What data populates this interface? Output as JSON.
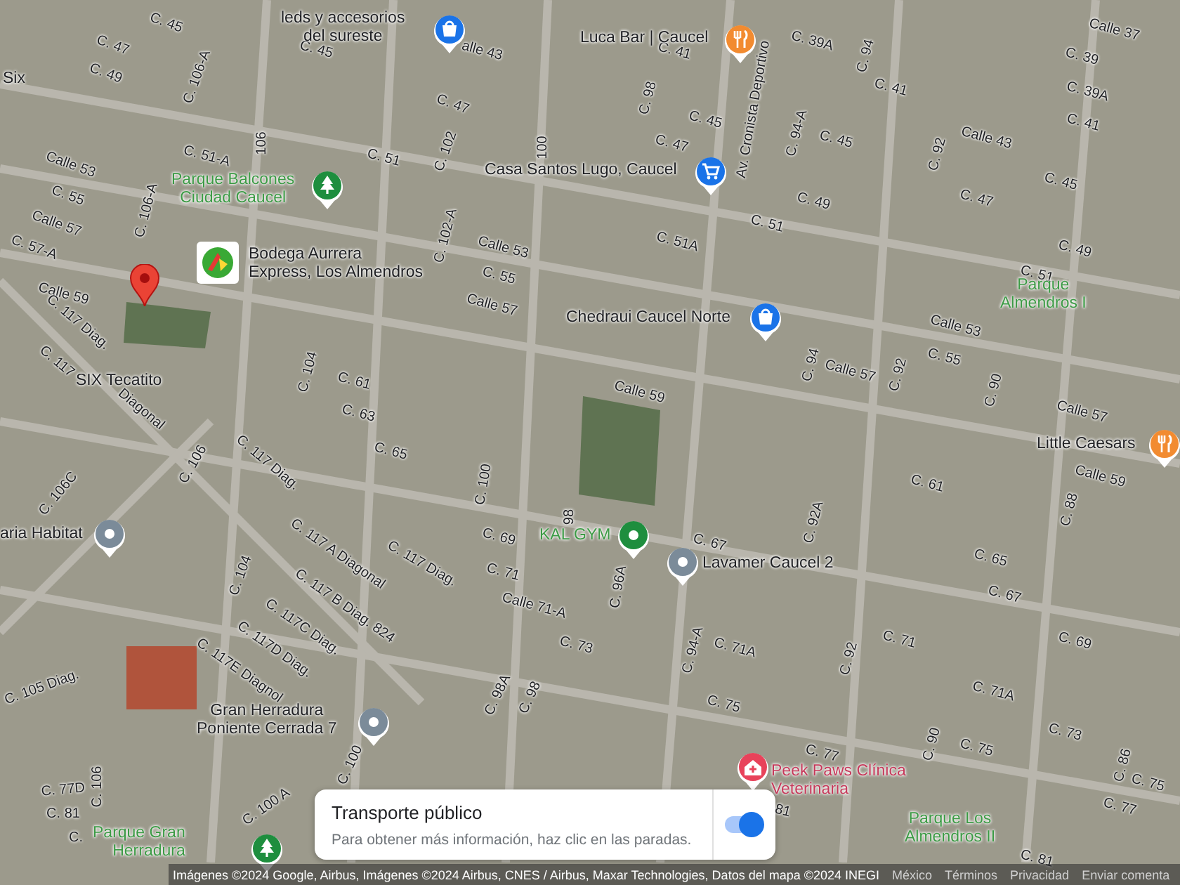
{
  "map": {
    "places": [
      {
        "lines": [
          "leds y accesorios",
          "del sureste"
        ],
        "kind": "shopping",
        "color": "#1a73e8"
      },
      {
        "lines": [
          "Luca Bar | Caucel"
        ],
        "kind": "restaurant",
        "color": "#f28b30"
      },
      {
        "lines": [
          "Casa Santos Lugo, Caucel"
        ],
        "kind": "grocery",
        "color": "#1a73e8"
      },
      {
        "lines": [
          "Parque Balcones",
          "Ciudad Caucel"
        ],
        "kind": "park",
        "color": "#1e8e3e"
      },
      {
        "lines": [
          "Bodega Aurrera",
          "Express, Los Almendros"
        ],
        "kind": "store-logo",
        "color": "#3aa935"
      },
      {
        "lines": [
          "Chedraui Caucel Norte"
        ],
        "kind": "shopping",
        "color": "#1a73e8"
      },
      {
        "lines": [
          "Parque",
          "Almendros I"
        ],
        "kind": "area"
      },
      {
        "lines": [
          "SIX Tecatito"
        ],
        "kind": "label"
      },
      {
        "lines": [
          "Six"
        ],
        "kind": "label"
      },
      {
        "lines": [
          "Little Caesars"
        ],
        "kind": "restaurant",
        "color": "#f28b30"
      },
      {
        "lines": [
          "aria Habitat"
        ],
        "kind": "generic",
        "color": "#7b8b99"
      },
      {
        "lines": [
          "KAL GYM"
        ],
        "kind": "gym",
        "color": "#1e8e3e"
      },
      {
        "lines": [
          "Lavamer Caucel 2"
        ],
        "kind": "generic",
        "color": "#7b8b99"
      },
      {
        "lines": [
          "Gran Herradura",
          "Poniente Cerrada 7"
        ],
        "kind": "generic",
        "color": "#7b8b99"
      },
      {
        "lines": [
          "Peek Paws Clínica",
          "Veterinaria"
        ],
        "kind": "vet",
        "color": "#e8425a"
      },
      {
        "lines": [
          "Parque Los",
          "Almendros II"
        ],
        "kind": "area"
      },
      {
        "lines": [
          "Parque Gran",
          "Herradura"
        ],
        "kind": "park",
        "color": "#1e8e3e"
      }
    ],
    "streets": [
      "C. 45",
      "C. 47",
      "C. 49",
      "C. 106-A",
      "C. 45",
      "alle 43",
      "C. 47",
      "C. 102",
      "C. 51",
      "100",
      "C. 51-A",
      "106",
      "Calle 53",
      "C. 55",
      "Calle 57",
      "C. 57-A",
      "C. 106-A",
      "C. 102-A",
      "Calle 53",
      "C. 55",
      "Calle 59",
      "C. 117 Diag.",
      "C. 117",
      "Diagonal",
      "Calle 57",
      "C. 104",
      "C. 61",
      "C. 63",
      "C. 65",
      "C. 106C",
      "C. 106",
      "C. 117 Diag.",
      "C. 100",
      "98",
      "C. 69",
      "C. 117 A Diagonal",
      "C. 117 Diag.",
      "C. 104",
      "C. 71",
      "C. 117 B Diag. 824",
      "C. 117C Diag.",
      "C. 117D Diag.",
      "C. 117E Diagnol",
      "C. 105 Diag.",
      "Calle 71-A",
      "C. 73",
      "C. 98A",
      "C. 98",
      "C. 100",
      "C. 100 A",
      "C. 77D",
      "C. 106",
      "C. 81",
      "C.",
      "C. 41",
      "C. 39A",
      "C. 94",
      "Calle 37",
      "C. 39",
      "C. 39A",
      "C. 41",
      "C. 98",
      "C. 41",
      "C. 45",
      "Av. Cronista Deportivo",
      "C. 94-A",
      "C. 45",
      "Calle 43",
      "C. 47",
      "C. 92",
      "C. 45",
      "C. 47",
      "C. 49",
      "C. 51",
      "C. 51A",
      "C. 49",
      "C. 51",
      "Calle 53",
      "C. 55",
      "Calle 57",
      "C. 94",
      "C. 92",
      "C. 90",
      "Calle 59",
      "Calle 57",
      "C. 61",
      "Calle 59",
      "C. 92A",
      "C. 88",
      "C. 67",
      "C. 65",
      "C. 96A",
      "C. 94-A",
      "C. 71A",
      "C. 92",
      "C. 71",
      "C. 67",
      "C. 69",
      "C. 71A",
      "C. 75",
      "C. 73",
      "C. 90",
      "C. 75",
      "C. 77",
      "C. 86",
      "C. 75",
      "C. 77",
      "81",
      "C. 81"
    ]
  },
  "transit_card": {
    "title": "Transporte público",
    "hint": "Para obtener más información, haz clic en las paradas.",
    "on": true
  },
  "footer": {
    "attribution": "Imágenes ©2024 Google, Airbus, Imágenes ©2024 Airbus, CNES / Airbus, Maxar Technologies, Datos del mapa ©2024 INEGI",
    "links": [
      "México",
      "Términos",
      "Privacidad",
      "Enviar comenta"
    ]
  }
}
